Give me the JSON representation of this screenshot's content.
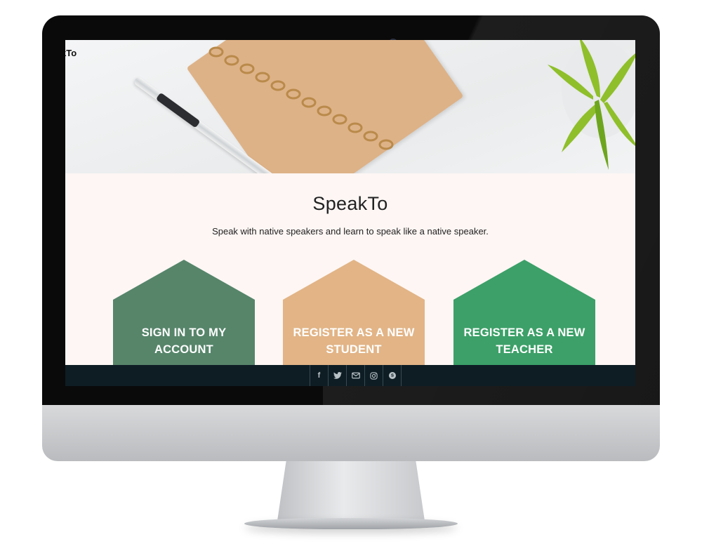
{
  "site": {
    "brand": "kTo",
    "title": "SpeakTo",
    "tagline": "Speak with native speakers and learn to speak like a native speaker."
  },
  "cards": [
    {
      "label": "SIGN IN TO MY ACCOUNT",
      "color": "#56856a"
    },
    {
      "label": "REGISTER AS A NEW STUDENT",
      "color": "#e2b486"
    },
    {
      "label": "REGISTER AS A NEW TEACHER",
      "color": "#3ca068"
    }
  ],
  "footer": {
    "social_icons": [
      "facebook-icon",
      "twitter-icon",
      "envelope-icon",
      "instagram-icon",
      "skype-icon"
    ],
    "facebook_glyph": "f",
    "background": "#0e1d24"
  }
}
